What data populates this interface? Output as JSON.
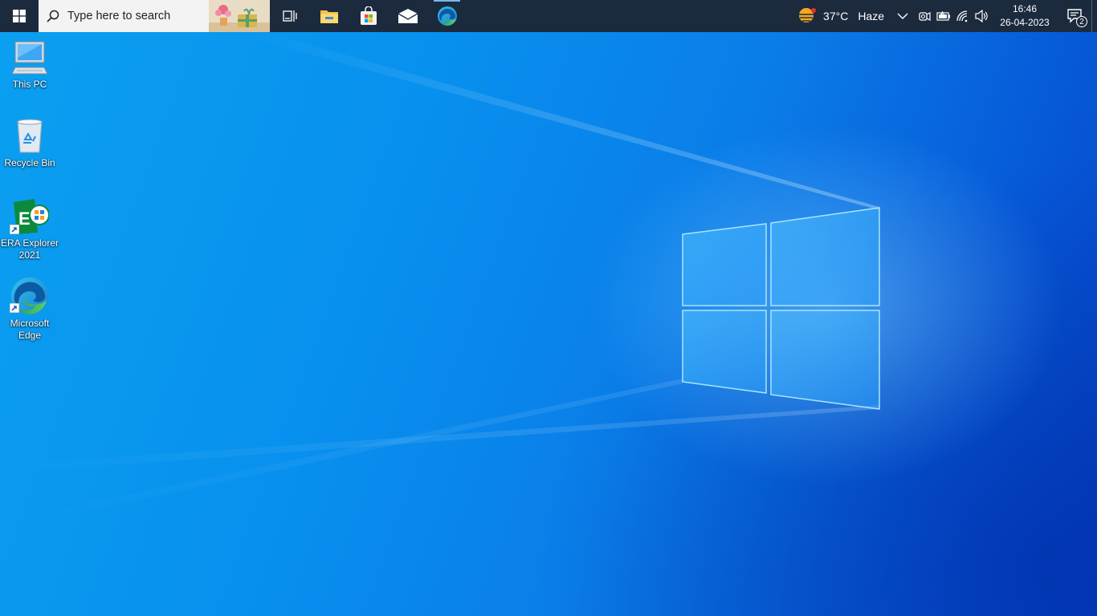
{
  "taskbar": {
    "start_icon": "windows-logo-icon",
    "search": {
      "placeholder": "Type here to search",
      "icon": "search-icon"
    },
    "apps": [
      {
        "name": "Task View",
        "icon": "task-view-icon"
      },
      {
        "name": "File Explorer",
        "icon": "folder-icon"
      },
      {
        "name": "Microsoft Store",
        "icon": "store-icon"
      },
      {
        "name": "Mail",
        "icon": "mail-icon"
      },
      {
        "name": "Microsoft Edge",
        "icon": "edge-icon",
        "active": true
      }
    ],
    "weather": {
      "temperature": "37°C",
      "condition": "Haze",
      "icon": "sun-haze-icon"
    },
    "tray_icons": [
      "chevron-up-icon",
      "meet-now-icon",
      "battery-icon",
      "wifi-icon",
      "volume-icon"
    ],
    "clock": {
      "time": "16:46",
      "date": "26-04-2023"
    },
    "notifications": {
      "count": "2",
      "icon": "action-center-icon"
    }
  },
  "desktop": {
    "icons": [
      {
        "label": "This PC",
        "icon": "computer-icon"
      },
      {
        "label": "Recycle Bin",
        "icon": "recycle-bin-icon"
      },
      {
        "label": "ERA Explorer 2021",
        "icon": "era-explorer-icon",
        "shortcut": true
      },
      {
        "label": "Microsoft Edge",
        "icon": "edge-icon",
        "shortcut": true
      }
    ]
  },
  "colors": {
    "taskbar_bg": "#1c2a3e",
    "wallpaper_blue": "#0a8fee",
    "active_indicator": "#76b9ed"
  }
}
